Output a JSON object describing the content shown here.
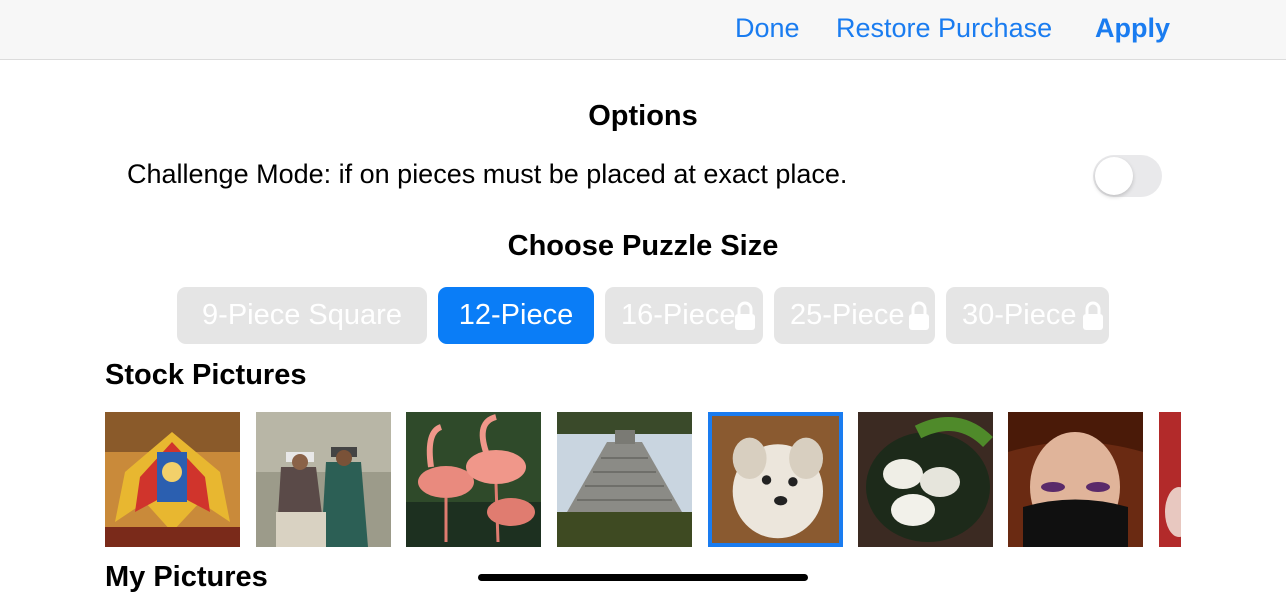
{
  "navbar": {
    "done_label": "Done",
    "restore_label": "Restore Purchase",
    "apply_label": "Apply",
    "accent_color": "#1a7cf0"
  },
  "options": {
    "title": "Options",
    "challenge_label": "Challenge Mode: if on pieces must be placed at exact place.",
    "challenge_on": false
  },
  "puzzle_size": {
    "title": "Choose Puzzle Size",
    "segments": [
      {
        "label": "9-Piece Square",
        "selected": false,
        "locked": false
      },
      {
        "label": "12-Piece",
        "selected": true,
        "locked": false
      },
      {
        "label": "16-Piece",
        "selected": false,
        "locked": true
      },
      {
        "label": "25-Piece",
        "selected": false,
        "locked": true
      },
      {
        "label": "30-Piece",
        "selected": false,
        "locked": true
      }
    ],
    "selected_color": "#0a7df7"
  },
  "stock_pictures": {
    "title": "Stock Pictures",
    "items": [
      {
        "icon": "festival-costume-picture",
        "selected": false
      },
      {
        "icon": "andean-women-picture",
        "selected": false
      },
      {
        "icon": "flamingos-picture",
        "selected": false
      },
      {
        "icon": "pyramid-picture",
        "selected": false
      },
      {
        "icon": "dog-picture",
        "selected": true
      },
      {
        "icon": "eggs-picture",
        "selected": false
      },
      {
        "icon": "masked-woman-picture",
        "selected": false
      },
      {
        "icon": "partial-picture",
        "selected": false
      }
    ]
  },
  "my_pictures": {
    "title": "My Pictures"
  }
}
